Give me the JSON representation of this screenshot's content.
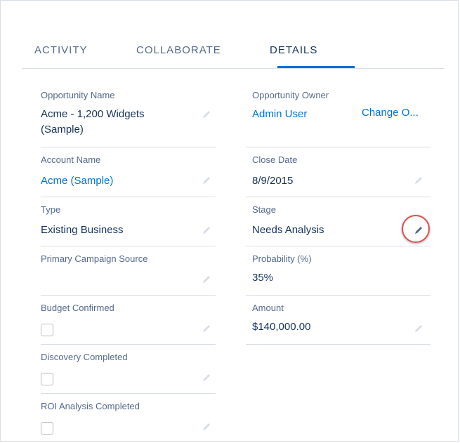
{
  "tabs": [
    {
      "label": "ACTIVITY",
      "active": false
    },
    {
      "label": "COLLABORATE",
      "active": false
    },
    {
      "label": "DETAILS",
      "active": true
    }
  ],
  "left_fields": [
    {
      "label": "Opportunity Name",
      "value": "Acme - 1,200 Widgets (Sample)",
      "type": "text"
    },
    {
      "label": "Account Name",
      "value": "Acme (Sample)",
      "type": "link"
    },
    {
      "label": "Type",
      "value": "Existing Business",
      "type": "text"
    },
    {
      "label": "Primary Campaign Source",
      "value": "",
      "type": "text"
    },
    {
      "label": "Budget Confirmed",
      "checked": false,
      "type": "checkbox"
    },
    {
      "label": "Discovery Completed",
      "checked": false,
      "type": "checkbox"
    },
    {
      "label": "ROI Analysis Completed",
      "checked": false,
      "type": "checkbox"
    }
  ],
  "right_fields": [
    {
      "label": "Opportunity Owner",
      "value": "Admin User",
      "type": "link",
      "action": "Change O..."
    },
    {
      "label": "Close Date",
      "value": "8/9/2015",
      "type": "text"
    },
    {
      "label": "Stage",
      "value": "Needs Analysis",
      "type": "text",
      "highlighted": true
    },
    {
      "label": "Probability (%)",
      "value": "35%",
      "type": "text"
    },
    {
      "label": "Amount",
      "value": "$140,000.00",
      "type": "text"
    }
  ],
  "colors": {
    "accent": "#0070d2",
    "text": "#16325c",
    "label": "#54698d",
    "border": "#d8dde6",
    "highlight": "#d9534f"
  },
  "icons": {
    "edit": "pencil-icon",
    "checkbox": "checkbox"
  }
}
